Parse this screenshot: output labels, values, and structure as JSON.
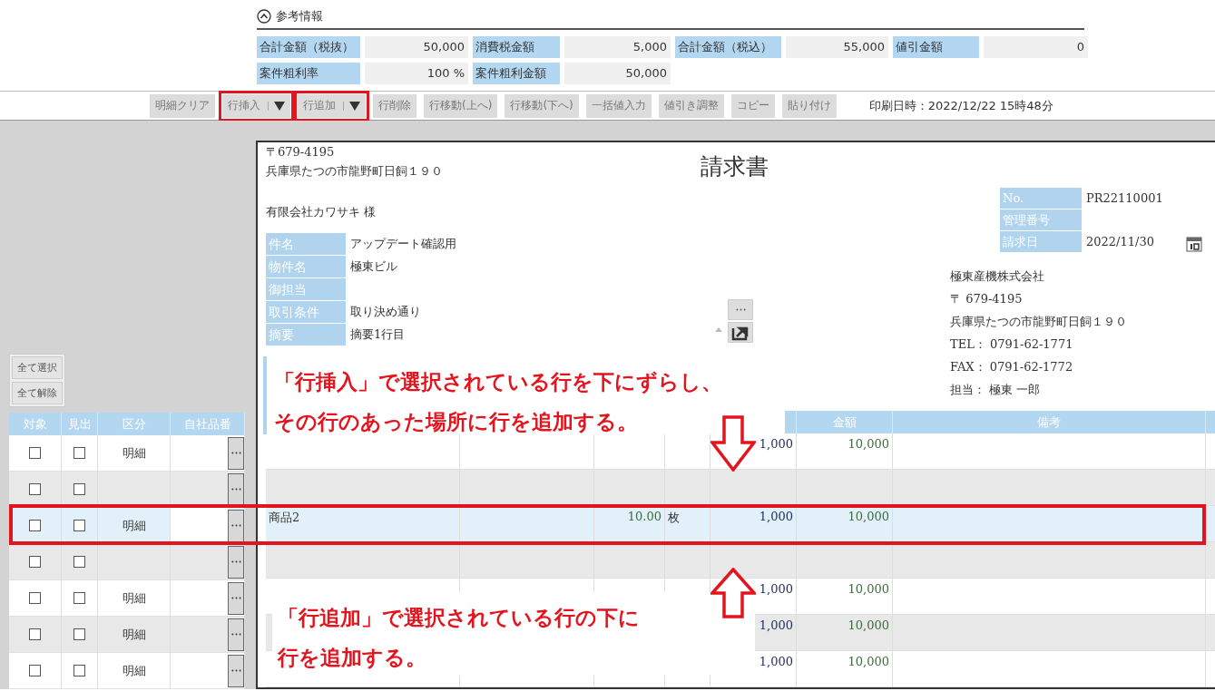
{
  "reference": {
    "title": "参考情報",
    "expanded": true,
    "items": [
      {
        "label": "合計金額（税抜）",
        "value": "50,000"
      },
      {
        "label": "消費税金額",
        "value": "5,000"
      },
      {
        "label": "合計金額（税込）",
        "value": "55,000"
      },
      {
        "label": "値引金額",
        "value": "0"
      },
      {
        "label": "案件粗利率",
        "value": "100 %"
      },
      {
        "label": "案件粗利金額",
        "value": "50,000"
      }
    ]
  },
  "toolbar": {
    "buttons": [
      {
        "label": "明細クリア",
        "kind": "plain",
        "highlighted": false
      },
      {
        "label": "行挿入",
        "kind": "split",
        "highlighted": true
      },
      {
        "label": "行追加",
        "kind": "split",
        "highlighted": true
      },
      {
        "label": "行削除",
        "kind": "plain",
        "highlighted": false
      },
      {
        "label": "行移動(上へ)",
        "kind": "plain",
        "highlighted": false
      },
      {
        "label": "行移動(下へ)",
        "kind": "plain",
        "highlighted": false
      },
      {
        "label": "一括値入力",
        "kind": "plain",
        "highlighted": false
      },
      {
        "label": "値引き調整",
        "kind": "plain",
        "highlighted": false
      },
      {
        "label": "コピー",
        "kind": "plain",
        "highlighted": false
      },
      {
        "label": "貼り付け",
        "kind": "plain",
        "highlighted": false
      }
    ],
    "print_date": "印刷日時：2022/12/22 15時48分"
  },
  "left_panel": {
    "buttons": [
      "全て選択",
      "全て解除"
    ],
    "columns": [
      "対象",
      "見出",
      "区分",
      "自社品番"
    ]
  },
  "invoice": {
    "postal": "〒679-4195",
    "address": "兵庫県たつの市龍野町日飼１９０",
    "title": "請求書",
    "customer": "有限会社カワサキ 様",
    "fields": [
      {
        "label": "件名",
        "value": "アップデート確認用"
      },
      {
        "label": "物件名",
        "value": "極東ビル"
      },
      {
        "label": "御担当"
      },
      {
        "label": "取引条件",
        "value": "取り決め通り"
      },
      {
        "label": "摘要",
        "value": "摘要1行目"
      }
    ],
    "info": [
      {
        "label": "No.",
        "value": "PR22110001"
      },
      {
        "label": "管理番号"
      },
      {
        "label": "請求日",
        "value": "2022/11/30"
      }
    ],
    "company": [
      "極東産機株式会社",
      "〒 679-4195",
      "兵庫県たつの市龍野町日飼１９０",
      "TEL： 0791-62-1771",
      "FAX： 0791-62-1772",
      "担当： 極東 一郎"
    ],
    "visible_columns": [
      "金額",
      "備考"
    ]
  },
  "rows": [
    {
      "target_checked": false,
      "heading_checked": false,
      "category": "明細",
      "selected": false,
      "price": "1,000",
      "amount": "10,000"
    },
    {
      "target_checked": false,
      "heading_checked": false,
      "selected": false
    },
    {
      "target_checked": false,
      "heading_checked": false,
      "category": "明細",
      "selected": true,
      "product": "商品2",
      "quantity": "10.00",
      "unit": "枚",
      "price": "1,000",
      "amount": "10,000"
    },
    {
      "target_checked": false,
      "heading_checked": false,
      "selected": false
    },
    {
      "target_checked": false,
      "heading_checked": false,
      "category": "明細",
      "selected": false,
      "price": "1,000",
      "amount": "10,000"
    },
    {
      "target_checked": false,
      "heading_checked": false,
      "category": "明細",
      "selected": false,
      "price": "1,000",
      "amount": "10,000"
    },
    {
      "target_checked": false,
      "heading_checked": false,
      "category": "明細",
      "selected": false,
      "price": "1,000",
      "amount": "10,000"
    }
  ],
  "callouts": [
    {
      "lines": [
        "「行挿入」で選択されている行を下にずらし、",
        "その行のあった場所に行を追加する。"
      ],
      "kind": "down_arrow"
    },
    {
      "lines": [
        "「行追加」で選択されている行の下に",
        "行を追加する。"
      ],
      "kind": "up_arrow"
    }
  ]
}
